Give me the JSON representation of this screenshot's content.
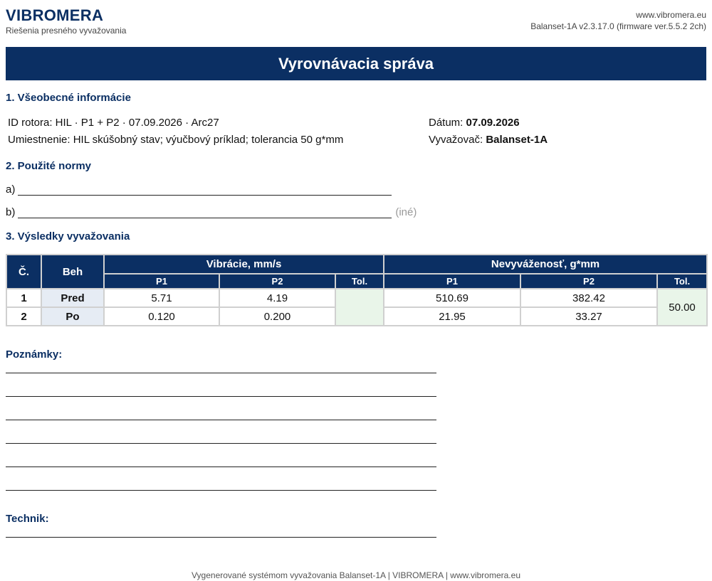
{
  "header": {
    "brand": "VIBROMERA",
    "tagline": "Riešenia presného vyvažovania",
    "website": "www.vibromera.eu",
    "version": "Balanset-1A v2.3.17.0 (firmware ver.5.5.2 2ch)"
  },
  "title": "Vyrovnávacia správa",
  "general": {
    "heading": "1. Všeobecné informácie",
    "rotor_id": "ID rotora: HIL · P1 + P2 · 07.09.2026 · Arc27",
    "location": "Umiestnenie: HIL skúšobný stav; výučbový príklad; tolerancia 50 g*mm",
    "date_label": "Dátum:",
    "date_value": "07.09.2026",
    "balancer_label": "Vyvažovač:",
    "balancer_value": "Balanset-1A"
  },
  "standards": {
    "heading": "2. Použité normy",
    "a_label": "a)",
    "b_label": "b)",
    "b_hint": "(iné)"
  },
  "results": {
    "heading": "3. Výsledky vyvažovania",
    "col_no": "Č.",
    "col_run": "Beh",
    "vib_group": "Vibrácie, mm/s",
    "unb_group": "Nevyváženosť, g*mm",
    "p1": "P1",
    "p2": "P2",
    "tol": "Tol.",
    "rows": [
      {
        "no": "1",
        "run": "Pred",
        "vib_p1": "5.71",
        "vib_p2": "4.19",
        "unb_p1": "510.69",
        "unb_p2": "382.42"
      },
      {
        "no": "2",
        "run": "Po",
        "vib_p1": "0.120",
        "vib_p2": "0.200",
        "unb_p1": "21.95",
        "unb_p2": "33.27"
      }
    ],
    "vib_tol": "",
    "unb_tol": "50.00"
  },
  "notes_label": "Poznámky:",
  "technician_label": "Technik:",
  "footer": "Vygenerované systémom vyvažovania Balanset-1A | VIBROMERA | www.vibromera.eu",
  "colors": {
    "primary": "#0b2f63",
    "tolerance_bg": "#e9f5e9",
    "run_bg": "#e6ecf4"
  }
}
